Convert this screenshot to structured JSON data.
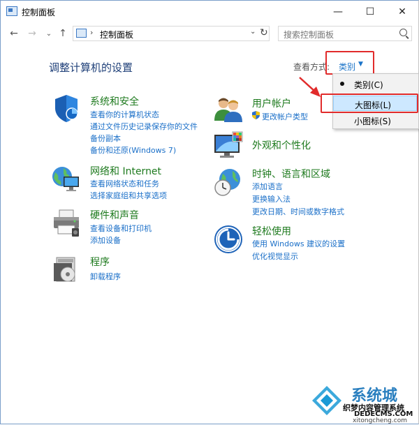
{
  "window": {
    "title": "控制面板",
    "minimize": "—",
    "maximize": "☐",
    "close": "✕"
  },
  "nav": {
    "back": "←",
    "forward": "→",
    "recent": "⌄",
    "up": "↑"
  },
  "address": {
    "separator": "›",
    "path": "控制面板",
    "dropdown": "⌄",
    "refresh": "↻"
  },
  "search": {
    "placeholder": "搜索控制面板"
  },
  "header": {
    "title": "调整计算机的设置",
    "view_by_label": "查看方式:",
    "view_by_value": "类别",
    "caret": "▼"
  },
  "menu": {
    "items": [
      {
        "label": "类别(C)",
        "selected": true
      },
      {
        "label": "大图标(L)",
        "highlighted": true
      },
      {
        "label": "小图标(S)"
      }
    ]
  },
  "categories": {
    "system": {
      "title": "系统和安全",
      "links": [
        "查看你的计算机状态",
        "通过文件历史记录保存你的文件",
        "备份副本",
        "备份和还原(Windows 7)"
      ]
    },
    "network": {
      "title": "网络和 Internet",
      "links": [
        "查看网络状态和任务",
        "选择家庭组和共享选项"
      ]
    },
    "hardware": {
      "title": "硬件和声音",
      "links": [
        "查看设备和打印机",
        "添加设备"
      ]
    },
    "programs": {
      "title": "程序",
      "links": [
        "卸载程序"
      ]
    },
    "user": {
      "title": "用户帐户",
      "links": [
        "更改帐户类型"
      ]
    },
    "appearance": {
      "title": "外观和个性化",
      "links": []
    },
    "clock": {
      "title": "时钟、语言和区域",
      "links": [
        "添加语言",
        "更换输入法",
        "更改日期、时间或数字格式"
      ]
    },
    "ease": {
      "title": "轻松使用",
      "links": [
        "使用 Windows 建议的设置",
        "优化视觉显示"
      ]
    }
  },
  "watermark": {
    "brand": "系统城",
    "line1": "织梦内容管理系统",
    "line2": "DEDECMS.COM",
    "line3": "xitongcheng.com"
  },
  "colors": {
    "category_title": "#1e7a1e",
    "link": "#1a6fc8",
    "highlight": "#e12b2b",
    "menu_hover": "#cde8ff"
  }
}
